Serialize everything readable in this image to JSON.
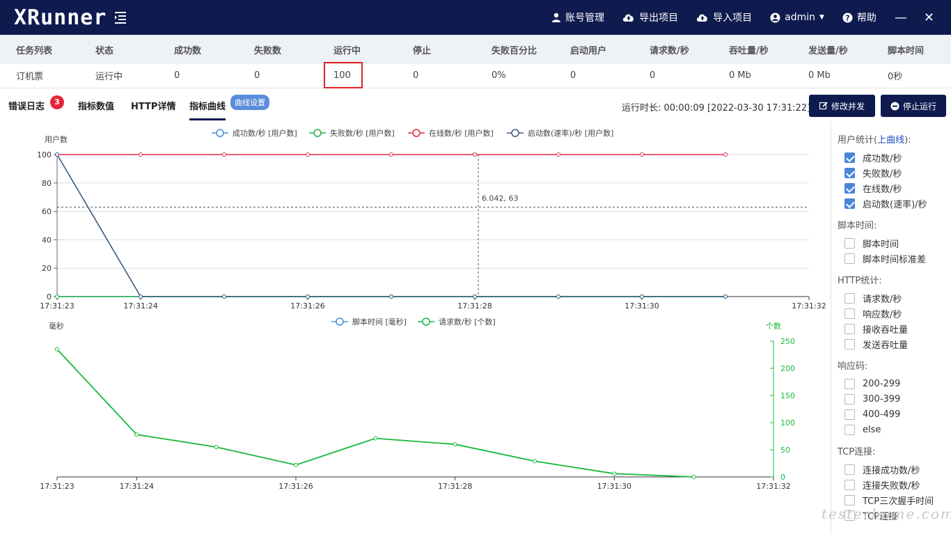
{
  "app": {
    "logo": "XRunner"
  },
  "topnav": {
    "account": "账号管理",
    "export": "导出项目",
    "import": "导入项目",
    "user": "admin",
    "help": "帮助",
    "minimize": "—",
    "close": "✕"
  },
  "task_table": {
    "headers": [
      "任务列表",
      "状态",
      "成功数",
      "失败数",
      "运行中",
      "停止",
      "失败百分比",
      "启动用户",
      "请求数/秒",
      "吞吐量/秒",
      "发送量/秒",
      "脚本时间"
    ],
    "row": [
      "订机票",
      "运行中",
      "0",
      "0",
      "100",
      "0",
      "0%",
      "0",
      "0",
      "0 Mb",
      "0 Mb",
      "0秒"
    ]
  },
  "tabs": {
    "error_log": "错误日志",
    "error_count": "3",
    "metric_values": "指标数值",
    "http_details": "HTTP详情",
    "metric_curves": "指标曲线",
    "curve_settings": "曲线设置"
  },
  "status": {
    "runtime": "运行时长: 00:00:09  [2022-03-30 17:31:22]",
    "modify_concurrency": "修改并发",
    "stop_run": "停止运行"
  },
  "colors": {
    "nav_bg": "#0f1b4f",
    "success": "#3f8fd8",
    "fail": "#23b344",
    "online": "#e0284a",
    "start": "#3a5a7e",
    "script": "#3f8fd8",
    "requests": "#18b83a"
  },
  "chart_data": [
    {
      "type": "line",
      "ylabel": "用户数",
      "ylim": [
        0,
        100
      ],
      "yticks": [
        "0",
        "20",
        "40",
        "60",
        "80",
        "100"
      ],
      "xticks": [
        "17:31:23",
        "17:31:24",
        "17:31:26",
        "17:31:28",
        "17:31:30",
        "17:31:32"
      ],
      "xlim": [
        0,
        9
      ],
      "legend_position": "top",
      "crosshair": {
        "x": 5.042,
        "y": 63,
        "label": "6.042, 63"
      },
      "series": [
        {
          "name": "成功数/秒 [用户数]",
          "color": "#3f8fd8",
          "x": [
            0,
            1,
            2,
            3,
            4,
            5,
            6,
            7,
            8
          ],
          "values": [
            0,
            0,
            0,
            0,
            0,
            0,
            0,
            0,
            0
          ]
        },
        {
          "name": "失败数/秒 [用户数]",
          "color": "#23b344",
          "x": [
            0,
            1,
            2,
            3,
            4,
            5,
            6,
            7,
            8
          ],
          "values": [
            0,
            0,
            0,
            0,
            0,
            0,
            0,
            0,
            0
          ]
        },
        {
          "name": "在线数/秒 [用户数]",
          "color": "#e0284a",
          "x": [
            0,
            1,
            2,
            3,
            4,
            5,
            6,
            7,
            8
          ],
          "values": [
            100,
            100,
            100,
            100,
            100,
            100,
            100,
            100,
            100
          ]
        },
        {
          "name": "启动数(速率)/秒 [用户数]",
          "color": "#3a5a7e",
          "x": [
            0,
            1,
            2,
            3,
            4,
            5,
            6,
            7,
            8
          ],
          "values": [
            100,
            0,
            0,
            0,
            0,
            0,
            0,
            0,
            0
          ]
        }
      ]
    },
    {
      "type": "line",
      "ylabel": "毫秒",
      "y2label": "个数",
      "y2lim": [
        0,
        250
      ],
      "y2ticks": [
        "0",
        "50",
        "100",
        "150",
        "200",
        "250"
      ],
      "xticks": [
        "17:31:23",
        "17:31:24",
        "17:31:26",
        "17:31:28",
        "17:31:30",
        "17:31:32"
      ],
      "xlim": [
        0,
        9
      ],
      "legend_position": "top",
      "series": [
        {
          "name": "脚本时间 [毫秒]",
          "color": "#3f8fd8",
          "x": [],
          "values": []
        },
        {
          "name": "请求数/秒 [个数]",
          "color": "#18b83a",
          "axis": "right",
          "x": [
            0,
            1,
            2,
            3,
            4,
            5,
            6,
            7,
            8
          ],
          "values": [
            235,
            78,
            55,
            22,
            71,
            60,
            29,
            6,
            0
          ]
        }
      ]
    }
  ],
  "side_panel": {
    "user_stats": {
      "title": "用户统计(",
      "link": "上曲线",
      "tail": "):"
    },
    "user_items": [
      {
        "label": "成功数/秒",
        "checked": true
      },
      {
        "label": "失败数/秒",
        "checked": true
      },
      {
        "label": "在线数/秒",
        "checked": true
      },
      {
        "label": "启动数(速率)/秒",
        "checked": true
      }
    ],
    "script_title": "脚本时间:",
    "script_items": [
      "脚本时间",
      "脚本时间标准差"
    ],
    "http_title": "HTTP统计:",
    "http_items": [
      "请求数/秒",
      "响应数/秒",
      "接收吞吐量",
      "发送吞吐量"
    ],
    "code_title": "响应码:",
    "code_items": [
      "200-299",
      "300-399",
      "400-499",
      "else"
    ],
    "tcp_title": "TCP连接:",
    "tcp_items": [
      "连接成功数/秒",
      "连接失败数/秒",
      "TCP三次握手时间",
      "TCP连接"
    ]
  },
  "watermark": "testerhome.com"
}
